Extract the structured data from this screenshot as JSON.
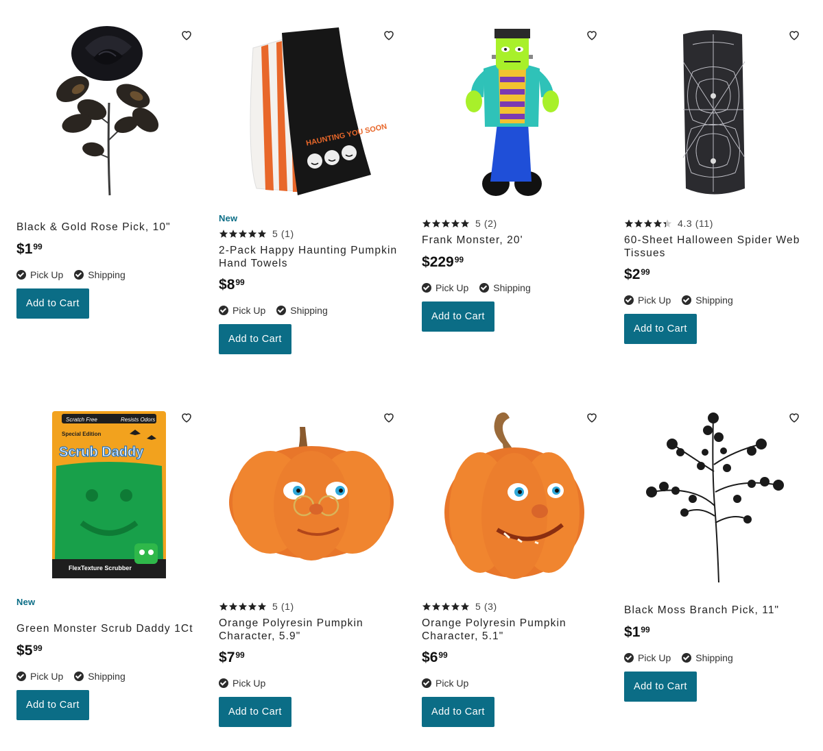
{
  "colors": {
    "accent": "#0b6d86",
    "new_badge": "#0b6d86"
  },
  "fulfillment": {
    "pickup": "Pick Up",
    "shipping": "Shipping"
  },
  "products": [
    {
      "image": "black-rose",
      "badge": "",
      "rating": "",
      "rating_value": null,
      "title": "Black & Gold Rose Pick, 10\"",
      "price": {
        "currency": "$",
        "dollars": "1",
        "cents": "99"
      },
      "pickup": true,
      "shipping": true,
      "cta": "Add to Cart"
    },
    {
      "image": "hand-towels",
      "badge": "New",
      "rating": "5 (1)",
      "rating_value": 5,
      "title": "2-Pack Happy Haunting Pumpkin Hand Towels",
      "price": {
        "currency": "$",
        "dollars": "8",
        "cents": "99"
      },
      "pickup": true,
      "shipping": true,
      "cta": "Add to Cart",
      "towel_text": "HAUNTING YOU SOON"
    },
    {
      "image": "frankenstein-inflatable",
      "badge": "",
      "rating": "5 (2)",
      "rating_value": 5,
      "title": "Frank Monster, 20'",
      "price": {
        "currency": "$",
        "dollars": "229",
        "cents": "99"
      },
      "pickup": true,
      "shipping": true,
      "cta": "Add to Cart"
    },
    {
      "image": "spider-web-tissues",
      "badge": "",
      "rating": "4.3 (11)",
      "rating_value": 4.3,
      "title": "60-Sheet Halloween Spider Web Tissues",
      "price": {
        "currency": "$",
        "dollars": "2",
        "cents": "99"
      },
      "pickup": true,
      "shipping": true,
      "cta": "Add to Cart"
    },
    {
      "image": "scrub-daddy",
      "badge": "New",
      "rating": "",
      "rating_value": null,
      "title": "Green Monster Scrub Daddy 1Ct",
      "price": {
        "currency": "$",
        "dollars": "5",
        "cents": "99"
      },
      "pickup": true,
      "shipping": true,
      "cta": "Add to Cart",
      "package_text": {
        "top_left": "Scratch Free",
        "top_right": "Resists Odors",
        "edition": "Special Edition",
        "brand": "Scrub Daddy",
        "bottom": "FlexTexture Scrubber"
      }
    },
    {
      "image": "pumpkin-glasses",
      "badge": "",
      "rating": "5 (1)",
      "rating_value": 5,
      "title": "Orange Polyresin Pumpkin Character, 5.9\"",
      "price": {
        "currency": "$",
        "dollars": "7",
        "cents": "99"
      },
      "pickup": true,
      "shipping": false,
      "cta": "Add to Cart"
    },
    {
      "image": "pumpkin-smile",
      "badge": "",
      "rating": "5 (3)",
      "rating_value": 5,
      "title": "Orange Polyresin Pumpkin Character, 5.1\"",
      "price": {
        "currency": "$",
        "dollars": "6",
        "cents": "99"
      },
      "pickup": true,
      "shipping": false,
      "cta": "Add to Cart"
    },
    {
      "image": "black-moss-branch",
      "badge": "",
      "rating": "",
      "rating_value": null,
      "title": "Black Moss Branch Pick, 11\"",
      "price": {
        "currency": "$",
        "dollars": "1",
        "cents": "99"
      },
      "pickup": true,
      "shipping": true,
      "cta": "Add to Cart"
    }
  ]
}
